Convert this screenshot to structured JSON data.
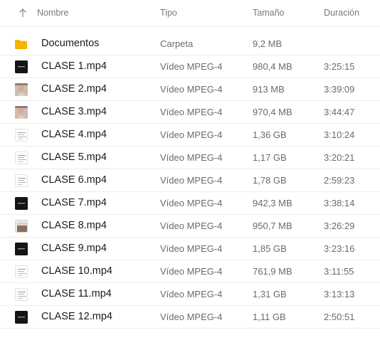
{
  "header": {
    "name": "Nombre",
    "type": "Tipo",
    "size": "Tamaño",
    "duration": "Duración",
    "sort_icon": "arrow-up-icon"
  },
  "colors": {
    "folder": "#f5b400",
    "row_divider": "#ececec",
    "muted_text": "#6b6b6b"
  },
  "rows": [
    {
      "name": "Documentos",
      "type": "Carpeta",
      "size": "9,2 MB",
      "duration": "",
      "icon": "folder-icon",
      "thumb": "folder"
    },
    {
      "name": "CLASE 1.mp4",
      "type": "Vídeo MPEG-4",
      "size": "980,4 MB",
      "duration": "3:25:15",
      "icon": "video-thumbnail-icon",
      "thumb": "dark-slide"
    },
    {
      "name": "CLASE 2.mp4",
      "type": "Vídeo MPEG-4",
      "size": "913 MB",
      "duration": "3:39:09",
      "icon": "video-thumbnail-icon",
      "thumb": "person"
    },
    {
      "name": "CLASE 3.mp4",
      "type": "Vídeo MPEG-4",
      "size": "970,4 MB",
      "duration": "3:44:47",
      "icon": "video-thumbnail-icon",
      "thumb": "person"
    },
    {
      "name": "CLASE 4.mp4",
      "type": "Vídeo MPEG-4",
      "size": "1,36 GB",
      "duration": "3:10:24",
      "icon": "video-thumbnail-icon",
      "thumb": "document"
    },
    {
      "name": "CLASE 5.mp4",
      "type": "Vídeo MPEG-4",
      "size": "1,17 GB",
      "duration": "3:20:21",
      "icon": "video-thumbnail-icon",
      "thumb": "document"
    },
    {
      "name": "CLASE 6.mp4",
      "type": "Vídeo MPEG-4",
      "size": "1,78 GB",
      "duration": "2:59:23",
      "icon": "video-thumbnail-icon",
      "thumb": "document"
    },
    {
      "name": "CLASE 7.mp4",
      "type": "Vídeo MPEG-4",
      "size": "942,3 MB",
      "duration": "3:38:14",
      "icon": "video-thumbnail-icon",
      "thumb": "dark-slide"
    },
    {
      "name": "CLASE 8.mp4",
      "type": "Vídeo MPEG-4",
      "size": "950,7 MB",
      "duration": "3:26:29",
      "icon": "video-thumbnail-icon",
      "thumb": "room"
    },
    {
      "name": "CLASE 9.mp4",
      "type": "Vídeo MPEG-4",
      "size": "1,85 GB",
      "duration": "3:23:16",
      "icon": "video-thumbnail-icon",
      "thumb": "dark-slide"
    },
    {
      "name": "CLASE 10.mp4",
      "type": "Vídeo MPEG-4",
      "size": "761,9 MB",
      "duration": "3:11:55",
      "icon": "video-thumbnail-icon",
      "thumb": "document"
    },
    {
      "name": "CLASE 11.mp4",
      "type": "Vídeo MPEG-4",
      "size": "1,31 GB",
      "duration": "3:13:13",
      "icon": "video-thumbnail-icon",
      "thumb": "document"
    },
    {
      "name": "CLASE 12.mp4",
      "type": "Vídeo MPEG-4",
      "size": "1,11 GB",
      "duration": "2:50:51",
      "icon": "video-thumbnail-icon",
      "thumb": "dark-slide"
    }
  ]
}
